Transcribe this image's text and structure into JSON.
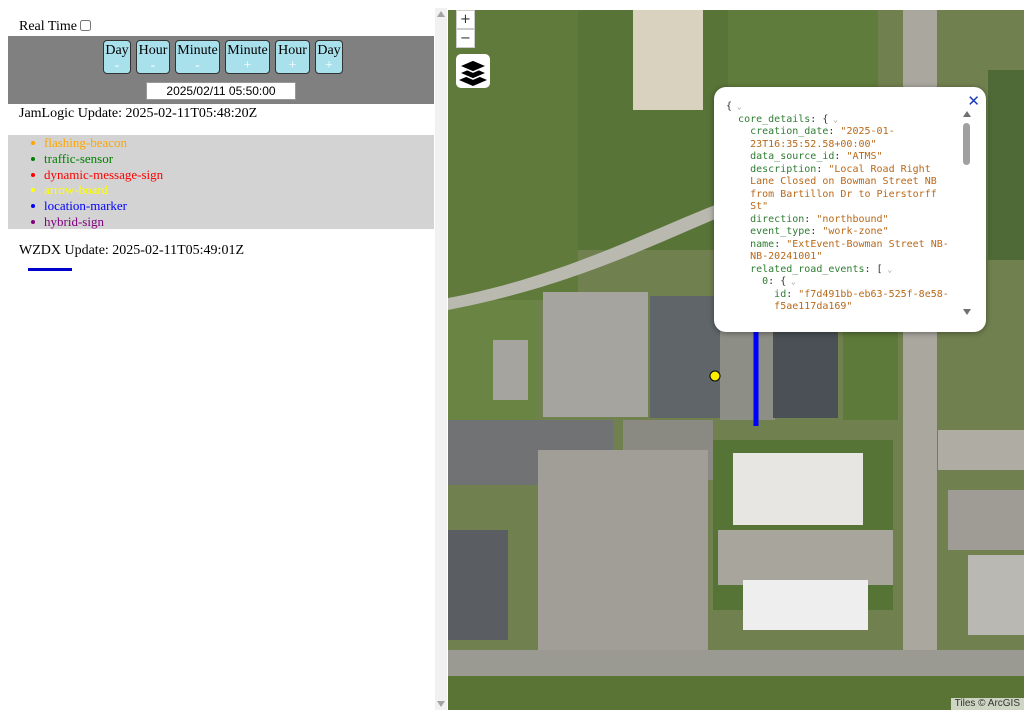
{
  "controls": {
    "real_time_label": "Real Time",
    "buttons": [
      {
        "unit": "Day",
        "sign": "-"
      },
      {
        "unit": "Hour",
        "sign": "-"
      },
      {
        "unit": "Minute",
        "sign": "-"
      },
      {
        "unit": "Minute",
        "sign": "+"
      },
      {
        "unit": "Hour",
        "sign": "+"
      },
      {
        "unit": "Day",
        "sign": "+"
      }
    ],
    "datetime_value": "2025/02/11 05:50:00"
  },
  "jamlogic": {
    "status": "JamLogic Update: 2025-02-11T05:48:20Z"
  },
  "legend": {
    "items": [
      {
        "label": "flashing-beacon",
        "color": "#ffa500"
      },
      {
        "label": "traffic-sensor",
        "color": "#008000"
      },
      {
        "label": "dynamic-message-sign",
        "color": "#ff0000"
      },
      {
        "label": "arrow-board",
        "color": "#ffff00"
      },
      {
        "label": "location-marker",
        "color": "#0000ff"
      },
      {
        "label": "hybrid-sign",
        "color": "#800080"
      }
    ]
  },
  "wzdx": {
    "status": "WZDX Update: 2025-02-11T05:49:01Z",
    "line_color": "#0000cc"
  },
  "map": {
    "zoom_in": "+",
    "zoom_out": "−",
    "layers_icon": "layers-icon",
    "attribution": "Tiles © ArcGIS"
  },
  "popup": {
    "close": "✕",
    "json_lines": [
      {
        "t": "{"
      },
      {
        "k": "core_details",
        "t": ": {"
      },
      {
        "k": "creation_date",
        "s": "\"2025-01-"
      },
      {
        "s": "23T16:35:52.58+00:00\""
      },
      {
        "k": "data_source_id",
        "s": "\"ATMS\""
      },
      {
        "k": "description",
        "s": "\"Local Road Right"
      },
      {
        "s": "Lane Closed on Bowman Street NB"
      },
      {
        "s": "from Bartillon Dr to Pierstorff"
      },
      {
        "s": "St\""
      },
      {
        "k": "direction",
        "s": "\"northbound\""
      },
      {
        "k": "event_type",
        "s": "\"work-zone\""
      },
      {
        "k": "name",
        "s": "\"ExtEvent-Bowman Street NB-"
      },
      {
        "s": "NB-20241001\""
      },
      {
        "k": "related_road_events",
        "t": ": ["
      },
      {
        "k": "0",
        "t": ": {"
      },
      {
        "k": "id",
        "s": "\"f7d491bb-eb63-525f-8e58-"
      },
      {
        "s": "f5ae117da169\""
      }
    ]
  }
}
